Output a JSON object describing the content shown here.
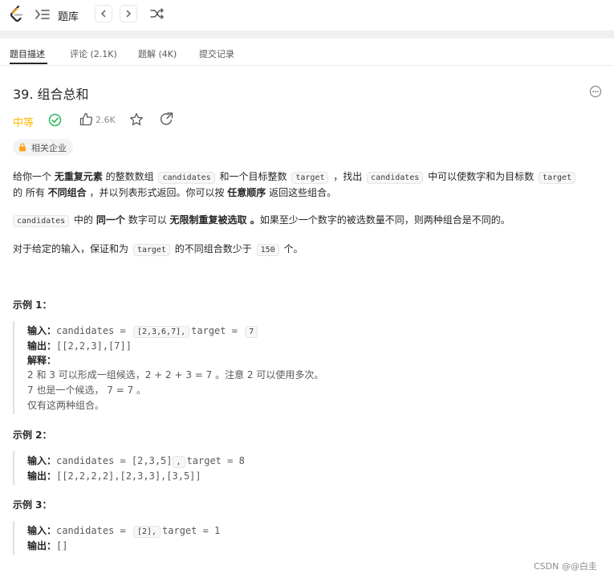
{
  "topbar": {
    "logo": "leetcode-logo",
    "list_label": "题库",
    "prev_icon": "chevron-left-icon",
    "next_icon": "chevron-right-icon",
    "shuffle_icon": "shuffle-icon"
  },
  "tabs": [
    {
      "label": "题目描述",
      "active": true
    },
    {
      "label": "评论 (2.1K)",
      "active": false
    },
    {
      "label": "题解 (4K)",
      "active": false
    },
    {
      "label": "提交记录",
      "active": false
    }
  ],
  "problem": {
    "title": "39. 组合总和",
    "difficulty": "中等",
    "difficulty_color": "#ffb800",
    "likes": "2.6K",
    "company_tag": "相关企业"
  },
  "description": {
    "p1": {
      "t1": "给你一个 ",
      "b1": "无重复元素",
      "t2": " 的整数数组 ",
      "c1": "candidates",
      "t3": " 和一个目标整数 ",
      "c2": "target",
      "t4": " ，找出 ",
      "c3": "candidates",
      "t5": " 中可以使数字和为目标数 ",
      "c4": "target",
      "t6": "的 所有 ",
      "b2": "不同组合",
      "t7": " ，并以列表形式返回。你可以按 ",
      "b3": "任意顺序",
      "t8": " 返回这些组合。"
    },
    "p2": {
      "c1": "candidates",
      "t1": " 中的 ",
      "b1": "同一个",
      "t2": " 数字可以 ",
      "b2": "无限制重复被选取 。",
      "t3": "如果至少一个数字的被选数量不同，则两种组合是不同的。"
    },
    "p3": {
      "t1": "对于给定的输入，保证和为 ",
      "c1": "target",
      "t2": " 的不同组合数少于 ",
      "c2": "150",
      "t3": " 个。"
    }
  },
  "examples": [
    {
      "title": "示例 1：",
      "input_key": "输入：",
      "input_a": "candidates = ",
      "input_code": "[2,3,6,7],",
      "input_b": "target = ",
      "input_code2": "7",
      "output_key": "输出：",
      "output": "[[2,2,3],[7]]",
      "explain_key": "解释：",
      "explain_lines": [
        "2 和 3 可以形成一组候选，2 + 2 + 3 = 7 。注意 2 可以使用多次。",
        "7 也是一个候选， 7 = 7 。",
        "仅有这两种组合。"
      ]
    },
    {
      "title": "示例 2：",
      "input_key": "输入：",
      "input_a": "candidates = [2,3,5]",
      "input_code": ",",
      "input_b": "target = 8",
      "output_key": "输出：",
      "output": "[[2,2,2,2],[2,3,3],[3,5]]"
    },
    {
      "title": "示例 3：",
      "input_key": "输入：",
      "input_a": "candidates = ",
      "input_code": "[2],",
      "input_b": "target = 1",
      "output_key": "输出：",
      "output": "[]"
    }
  ],
  "watermark": "CSDN @@白圭"
}
